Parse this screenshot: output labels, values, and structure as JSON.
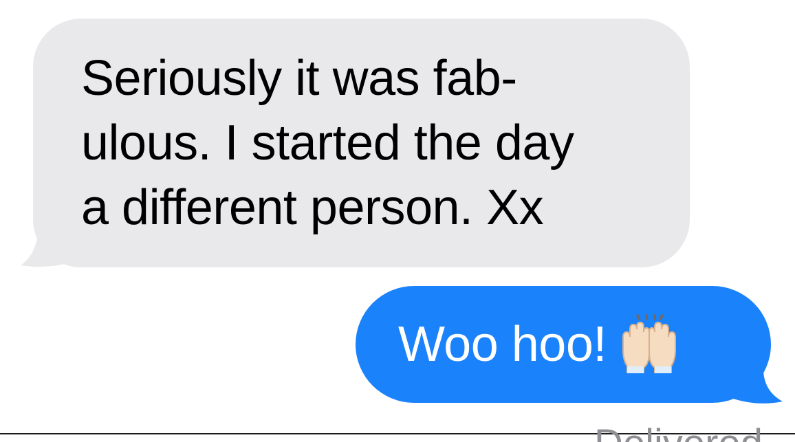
{
  "thread": {
    "incoming_message": {
      "lines": [
        "Seriously it was fab-",
        "ulous. I started the day",
        "a different person. Xx"
      ]
    },
    "outgoing_message": {
      "text": "Woo hoo!",
      "emoji": "raising-hands-emoji"
    },
    "status": "Delivered"
  },
  "colors": {
    "incoming_bubble": "#e9e9eb",
    "outgoing_bubble": "#1a82fb",
    "status_text": "#8e8e93"
  }
}
